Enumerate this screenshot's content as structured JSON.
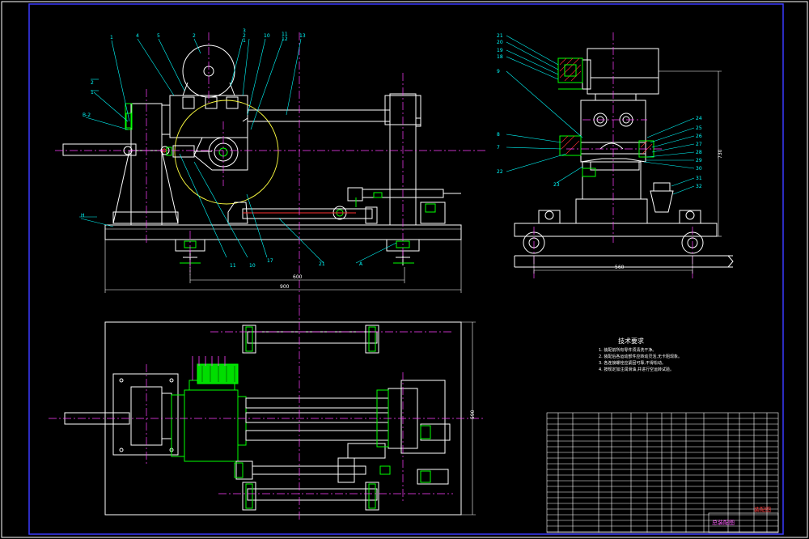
{
  "drawing": {
    "colors": {
      "background": "#000000",
      "outline": "#ffffff",
      "frame": "#3a3aff",
      "centerline": "#ff40ff",
      "part": "#00ff00",
      "dimension": "#00ffff",
      "highlight": "#ffff40",
      "accent": "#ff3030"
    },
    "front_view": {
      "callouts": [
        "1",
        "4",
        "5",
        "2",
        "3",
        "2",
        "1",
        "10",
        "11",
        "12",
        "13",
        "14",
        "15",
        "16"
      ],
      "section_label": "B-2",
      "left_labels": [
        "2",
        "1"
      ],
      "base_label": "H",
      "bottom_callouts": [
        "11",
        "10",
        "17",
        "21",
        "A"
      ],
      "overall_dimension": "900",
      "inner_dimension": "600"
    },
    "side_view": {
      "left_callouts": [
        "21",
        "20",
        "19",
        "18",
        "9",
        "8",
        "7",
        "22",
        "23"
      ],
      "right_callouts": [
        "24",
        "25",
        "26",
        "27",
        "28",
        "29",
        "30",
        "31",
        "32"
      ],
      "height_dimension": "730",
      "width_dimension": "560"
    },
    "plan_view": {
      "length_dimension": "980",
      "height_dimension": "590"
    },
    "tech_notes": {
      "title": "技术要求",
      "lines": [
        "1. 装配前所有零件须清洗干净。",
        "2. 装配后各运动部件应转动灵活,无卡阻现象。",
        "3. 各连接螺栓应紧固可靠,不得松动。",
        "4. 按规定加注润滑油,并进行空运转试验。"
      ]
    },
    "title_block": {
      "drawing_title": "总装配图",
      "sheet_label": "装配图"
    }
  }
}
